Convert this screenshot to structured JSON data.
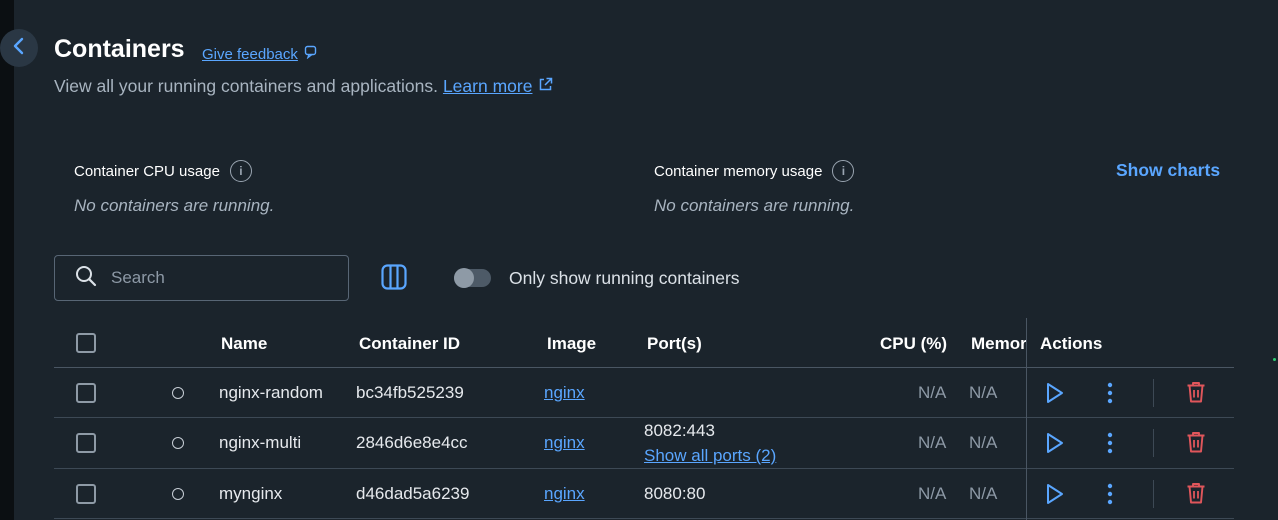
{
  "header": {
    "title": "Containers",
    "feedback_label": "Give feedback",
    "subtitle": "View all your running containers and applications.",
    "learn_more": "Learn more"
  },
  "usage": {
    "cpu_label": "Container CPU usage",
    "cpu_empty": "No containers are running.",
    "memory_label": "Container memory usage",
    "memory_empty": "No containers are running.",
    "show_charts": "Show charts"
  },
  "toolbar": {
    "search_placeholder": "Search",
    "toggle_label": "Only show running containers",
    "toggle_on": false
  },
  "table": {
    "columns": {
      "name": "Name",
      "container_id": "Container ID",
      "image": "Image",
      "ports": "Port(s)",
      "cpu": "CPU (%)",
      "memory": "Memor",
      "actions": "Actions"
    },
    "rows": [
      {
        "name": "nginx-random",
        "container_id": "bc34fb525239",
        "image": "nginx",
        "port": "",
        "show_ports": "",
        "cpu": "N/A",
        "memory": "N/A"
      },
      {
        "name": "nginx-multi",
        "container_id": "2846d6e8e4cc",
        "image": "nginx",
        "port": "8082:443",
        "show_ports": "Show all ports (2)",
        "cpu": "N/A",
        "memory": "N/A"
      },
      {
        "name": "mynginx",
        "container_id": "d46dad5a6239",
        "image": "nginx",
        "port": "8080:80",
        "show_ports": "",
        "cpu": "N/A",
        "memory": "N/A"
      }
    ]
  },
  "colors": {
    "accent": "#5aa6ff",
    "delete": "#e0565b",
    "background": "#1b242c"
  },
  "icons": [
    "chevron-left-icon",
    "feedback-icon",
    "external-link-icon",
    "info-icon",
    "search-icon",
    "columns-icon",
    "play-icon",
    "more-vertical-icon",
    "trash-icon"
  ]
}
